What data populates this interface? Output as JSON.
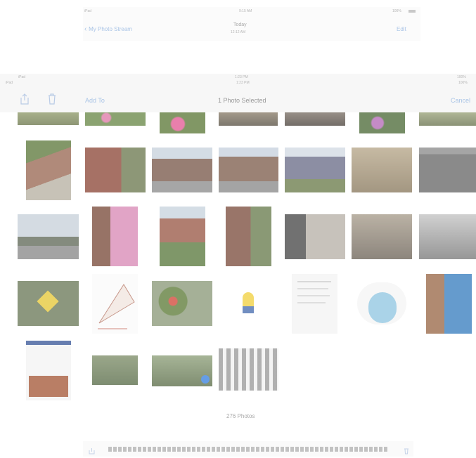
{
  "top": {
    "carrier": "iPad",
    "time": "9:15 AM",
    "battery": "100%",
    "back_label": "My Photo Stream",
    "title": "Today",
    "subtitle": "12:12 AM",
    "edit_label": "Edit"
  },
  "bar2": {
    "carrier_a": "iPad",
    "carrier_b": "iPad",
    "time_a": "1:23 PM",
    "time_b": "1:23 PM",
    "battery_a": "100%",
    "battery_b": "100%",
    "add_to_label": "Add To",
    "title": "1 Photo Selected",
    "cancel_label": "Cancel"
  },
  "footer": {
    "count_label": "276 Photos"
  },
  "icons": {
    "share": "share-icon",
    "trash": "trash-icon",
    "selected": "checkmark-icon"
  }
}
